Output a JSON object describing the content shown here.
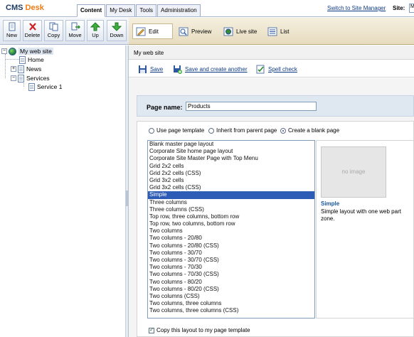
{
  "app": {
    "logo_main": "CMS",
    "logo_accent": "Desk"
  },
  "tabs": [
    "Content",
    "My Desk",
    "Tools",
    "Administration"
  ],
  "header": {
    "switch_link": "Switch to Site Manager",
    "site_label": "Site:",
    "site_value": "M"
  },
  "toolbar": {
    "buttons": [
      "New",
      "Delete",
      "Copy",
      "Move",
      "Up",
      "Down"
    ]
  },
  "modes": [
    "Edit",
    "Preview",
    "Live site",
    "List"
  ],
  "tree": {
    "root": "My web site",
    "items": [
      "Home",
      "News",
      "Services",
      "Service 1"
    ]
  },
  "breadcrumb": "My web site",
  "actions": {
    "save": "Save",
    "save_create": "Save and create another",
    "spell": "Spell check"
  },
  "form": {
    "page_name_label": "Page name:",
    "page_name_value": "Products"
  },
  "radios": {
    "use_template": "Use page template",
    "inherit": "Inherit from parent page",
    "blank": "Create a blank page"
  },
  "layouts": {
    "items": [
      "Blank master page layout",
      "Corporate Site home page layout",
      "Corporate Site Master Page with Top Menu",
      "Grid 2x2 cells",
      "Grid 2x2 cells (CSS)",
      "Grid 3x2 cells",
      "Grid 3x2 cells (CSS)",
      "Simple",
      "Three columns",
      "Three columns (CSS)",
      "Top row, three columns, bottom row",
      "Top row, two columns, bottom row",
      "Two columns",
      "Two columns - 20/80",
      "Two columns - 20/80 (CSS)",
      "Two columns - 30/70",
      "Two columns - 30/70 (CSS)",
      "Two columns - 70/30",
      "Two columns - 70/30 (CSS)",
      "Two columns - 80/20",
      "Two columns - 80/20 (CSS)",
      "Two columns (CSS)",
      "Two columns, three columns",
      "Two columns, three columns (CSS)"
    ],
    "selected": "Simple"
  },
  "preview": {
    "no_image": "no image",
    "title": "Simple",
    "description": "Simple layout with one web part zone."
  },
  "copy_checkbox": "Copy this layout to my page template",
  "colors": {
    "selection": "#2c5cb5",
    "link": "#0d3a82",
    "accent": "#f07b14"
  }
}
